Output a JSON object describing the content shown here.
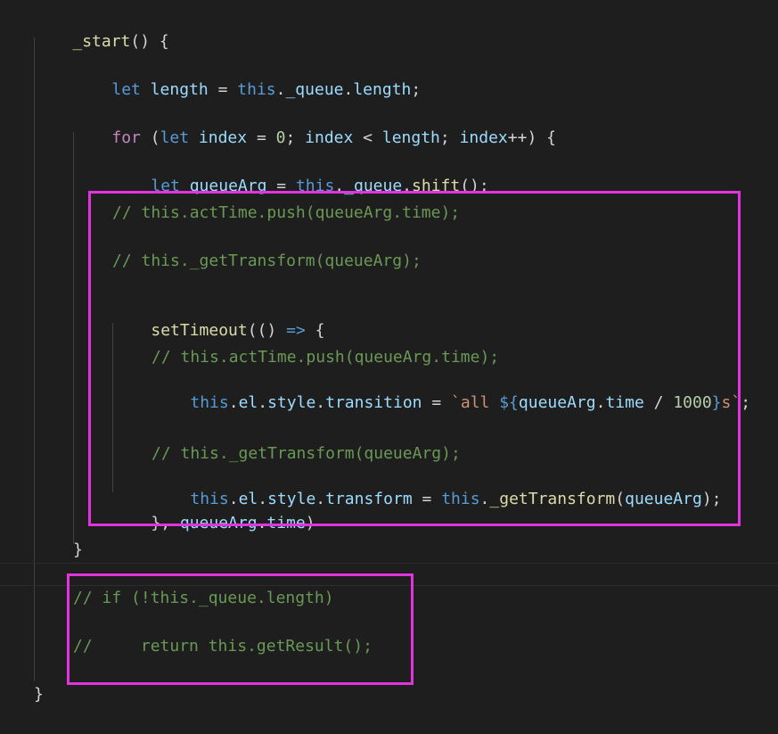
{
  "editor": {
    "theme_colors": {
      "background": "#1e1e1e",
      "highlight_border": "#e332e0",
      "keyword": "#569cd6",
      "control": "#c586c0",
      "variable": "#9cdcfe",
      "function": "#dcdcaa",
      "number": "#b5cea8",
      "comment": "#6a9955",
      "string": "#ce9178"
    },
    "lines": {
      "l1": {
        "name": "_start",
        "rest": "() {"
      },
      "l2": {
        "let": "let",
        "v": "length",
        "eq": " = ",
        "this": "this",
        "dot": ".",
        "q": "_queue",
        "dot2": ".",
        "len": "length",
        "end": ";"
      },
      "l3": {
        "for": "for",
        "p1": " (",
        "let": "let",
        "idx": "index",
        "eq": " = ",
        "zero": "0",
        "semi": "; ",
        "idx2": "index",
        "lt": " < ",
        "len": "length",
        "semi2": "; ",
        "idx3": "index",
        "pp": "++) {"
      },
      "l4": {
        "let": "let",
        "v": "queueArg",
        "eq": " = ",
        "this": "this",
        "dot": ".",
        "q": "_queue",
        "dot2": ".",
        "shift": "shift",
        "end": "();"
      },
      "l5": "// this.actTime.push(queueArg.time);",
      "l6": "// this._getTransform(queueArg);",
      "l7": {
        "fn": "setTimeout",
        "open": "((",
        "close": ") ",
        "arrow": "=>",
        "brace": " {"
      },
      "l8": "// this.actTime.push(queueArg.time);",
      "l9": {
        "this": "this",
        "dot": ".",
        "el": "el",
        "dot2": ".",
        "style": "style",
        "dot3": ".",
        "trans": "transition",
        "eq": " = ",
        "tick1": "`all ",
        "dollar": "${",
        "qa": "queueArg",
        "dot4": ".",
        "time": "time",
        "div": " / ",
        "num": "1000",
        "rb": "}",
        "s": "s`",
        "end": ";"
      },
      "l10": "// this._getTransform(queueArg);",
      "l11": {
        "this": "this",
        "dot": ".",
        "el": "el",
        "dot2": ".",
        "style": "style",
        "dot3": ".",
        "transform": "transform",
        "eq": " = ",
        "this2": "this",
        "dot4": ".",
        "fn": "_getTransform",
        "open": "(",
        "qa": "queueArg",
        "end": ");"
      },
      "l12": {
        "close": "}, ",
        "qa": "queueArg",
        "dot": ".",
        "time": "time",
        "end": ")"
      },
      "l13": "}",
      "l14": "// if (!this._queue.length)",
      "l15": "//     return this.getResult();",
      "l16": "}"
    }
  }
}
